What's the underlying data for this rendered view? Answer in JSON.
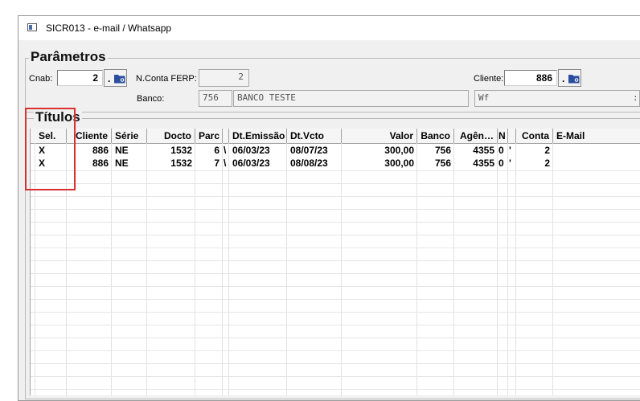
{
  "window": {
    "title": "SICR013 - e-mail / Whatsapp"
  },
  "parametros": {
    "title": "Parâmetros",
    "cnab_label": "Cnab:",
    "cnab_value": "2",
    "nconta_label": "N.Conta FERP:",
    "nconta_value": "2",
    "cliente_label": "Cliente:",
    "cliente_value": "886",
    "banco_label": "Banco:",
    "banco_code": "756",
    "banco_name": "BANCO TESTE",
    "extra_field": "Wf                           :"
  },
  "titulos": {
    "title": "Títulos",
    "columns": [
      "Sel.",
      "Cliente",
      "Série",
      "Docto",
      "Parc",
      "",
      "Dt.Emissão",
      "Dt.Vcto",
      "Valor",
      "Banco",
      "Agên…",
      "N",
      "",
      "Conta",
      "E-Mail"
    ],
    "rows": [
      [
        "X",
        "886",
        "NE",
        "1532",
        "6",
        "\\",
        "06/03/23",
        "08/07/23",
        "300,00",
        "756",
        "4355",
        "0",
        "'",
        "2",
        ""
      ],
      [
        "X",
        "886",
        "NE",
        "1532",
        "7",
        "\\",
        "06/03/23",
        "08/08/23",
        "300,00",
        "756",
        "4355",
        "0",
        "'",
        "2",
        ""
      ]
    ]
  },
  "colors": {
    "highlight": "#d93030",
    "window_bg": "#f0f0f0"
  }
}
